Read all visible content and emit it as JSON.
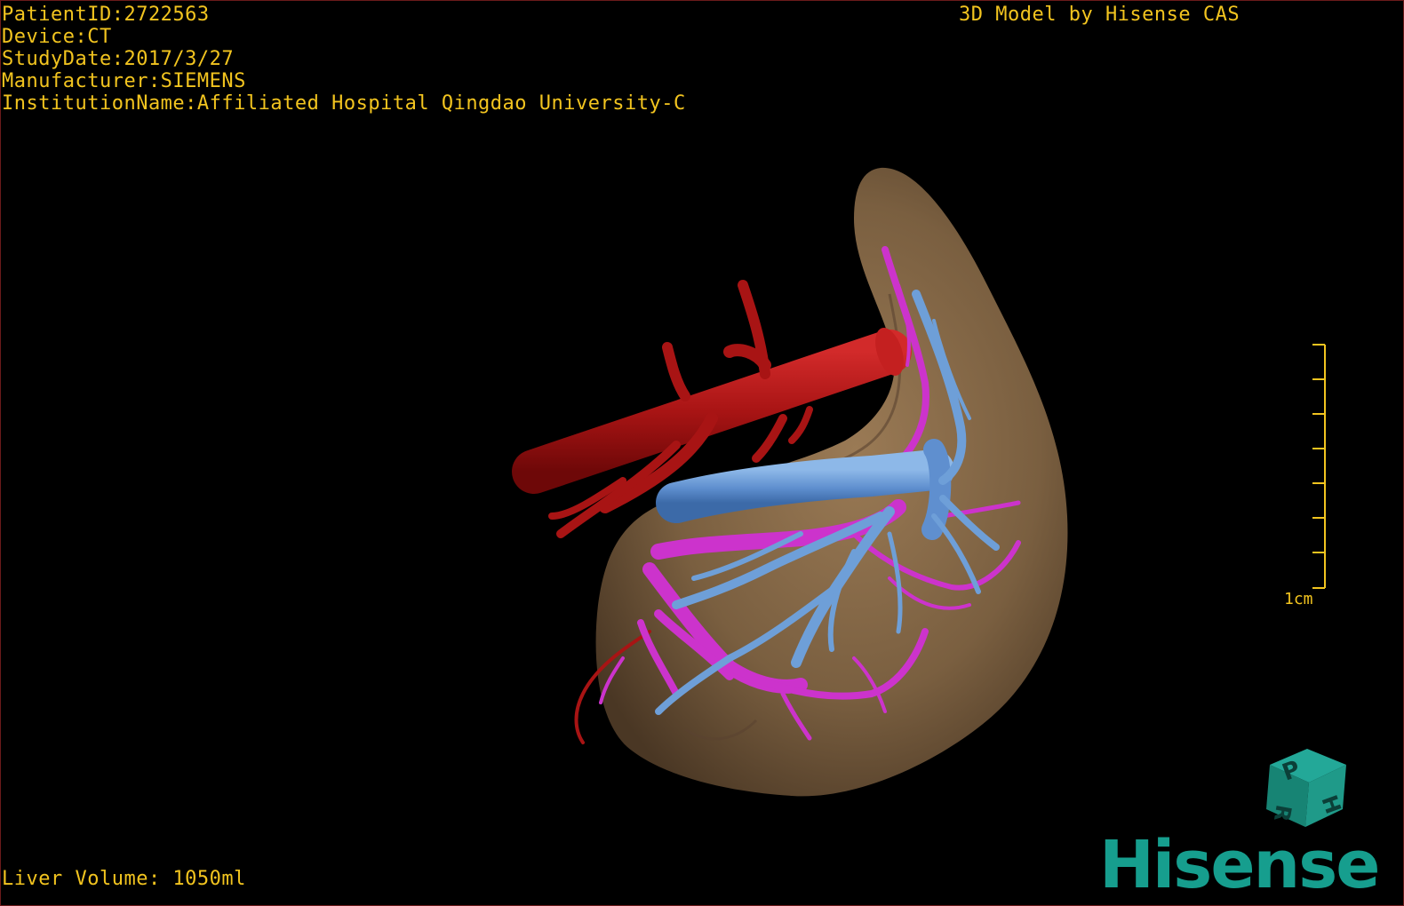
{
  "study_info": {
    "patient_id": "PatientID:2722563",
    "device": "Device:CT",
    "study_date": "StudyDate:2017/3/27",
    "manufacturer": "Manufacturer:SIEMENS",
    "institution": "InstitutionName:Affiliated Hospital Qingdao University-C"
  },
  "header_right": "3D Model by Hisense CAS",
  "footer_left": "Liver Volume: 1050ml",
  "scale_bar": {
    "label": "1cm"
  },
  "orientation_cube": {
    "face_labels": [
      "P",
      "H",
      "R"
    ]
  },
  "logo": "Hisense",
  "colors": {
    "overlay_text": "#f2c41f",
    "liver": "#7d6142",
    "artery": "#b01818",
    "portal_vein": "#6e9fd8",
    "hepatic_vein": "#cc33cc",
    "logo": "#169e8e",
    "cube": "#1a8f80"
  }
}
